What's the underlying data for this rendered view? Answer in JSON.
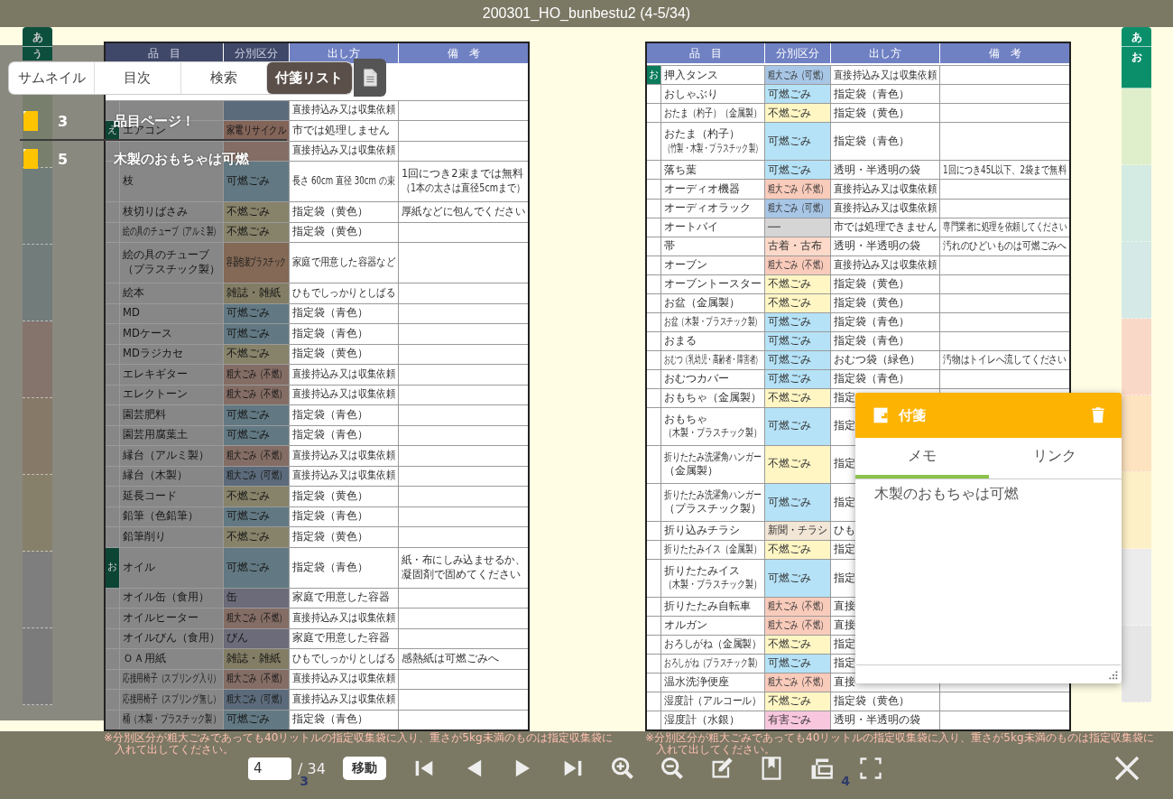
{
  "title": "200301_HO_bunbestu2 (4-5/34)",
  "left_index_tabs": [
    {
      "label": "あ",
      "color": "#0d4f3d"
    },
    {
      "label": "う",
      "color": "#0d4f3d"
    },
    {
      "color": "#787f6d"
    },
    {
      "color": "#717d79"
    },
    {
      "color": "#727c7b"
    },
    {
      "color": "#85746c"
    },
    {
      "color": "#867968"
    },
    {
      "color": "#86806b"
    },
    {
      "color": "#7e7e7e"
    },
    {
      "color": "#7b7b7b"
    }
  ],
  "right_index_tabs": [
    {
      "label": "あ",
      "color": "#0b8f6b"
    },
    {
      "label": "お",
      "color": "#0b8f6b"
    },
    {
      "color": "#e0efcb"
    },
    {
      "color": "#d3ebe3"
    },
    {
      "color": "#d5e9e6"
    },
    {
      "color": "#fad8c8"
    },
    {
      "color": "#fde3c0"
    },
    {
      "color": "#fdf0c6"
    },
    {
      "color": "#ececec"
    },
    {
      "color": "#e6e6e6"
    }
  ],
  "pages": [
    {
      "columns": [
        "品　目",
        "分別区分",
        "出し方",
        "備　考"
      ],
      "rows": [
        {
          "color": "#5c6b7b",
          "method": "直接持込み又は収集依頼"
        },
        {
          "kana": "え",
          "item": "エアコン",
          "class": "家電リサイクル",
          "color": "#836459",
          "method": "市では処理しません"
        },
        {
          "color": "#846d65",
          "method": "直接持込み又は収集依頼"
        },
        {
          "item": "枝",
          "class": "可燃ごみ",
          "color": "#627983",
          "method": "長さ 60cm 直径 30cm の束",
          "note": [
            "1回につき2束までは無料",
            "（1本の太さは直径5cmまで）"
          ]
        },
        {
          "item": "枝切りばさみ",
          "class": "不燃ごみ",
          "color": "#87836a",
          "method": "指定袋（黄色）",
          "note": "厚紙などに包んでください"
        },
        {
          "item": "絵の具のチューブ（アルミ製）",
          "class": "不燃ごみ",
          "color": "#87836a",
          "method": "指定袋（黄色）"
        },
        {
          "item": [
            "絵の具のチューブ",
            "（プラスチック製）"
          ],
          "class": "容器包装プラスチック",
          "color": "#836956",
          "method": "家庭で用意した容器など"
        },
        {
          "item": "絵本",
          "class": "雑誌・雑紙",
          "color": "#827d64",
          "method": "ひもでしっかりとしばる"
        },
        {
          "item": "MD",
          "class": "可燃ごみ",
          "color": "#627983",
          "method": "指定袋（青色）"
        },
        {
          "item": "MDケース",
          "class": "可燃ごみ",
          "color": "#627983",
          "method": "指定袋（青色）"
        },
        {
          "item": "MDラジカセ",
          "class": "不燃ごみ",
          "color": "#87836a",
          "method": "指定袋（黄色）"
        },
        {
          "item": "エレキギター",
          "class": "粗大ごみ（不燃）",
          "color": "#846d65",
          "method": "直接持込み又は収集依頼"
        },
        {
          "item": "エレクトーン",
          "class": "粗大ごみ（不燃）",
          "color": "#846d65",
          "method": "直接持込み又は収集依頼"
        },
        {
          "item": "園芸肥料",
          "class": "可燃ごみ",
          "color": "#627983",
          "method": "指定袋（青色）"
        },
        {
          "item": "園芸用腐葉土",
          "class": "可燃ごみ",
          "color": "#627983",
          "method": "指定袋（青色）"
        },
        {
          "item": "縁台（アルミ製）",
          "class": "粗大ごみ（不燃）",
          "color": "#846d65",
          "method": "直接持込み又は収集依頼"
        },
        {
          "item": "縁台（木製）",
          "class": "粗大ごみ（可燃）",
          "color": "#5c6b7b",
          "method": "直接持込み又は収集依頼"
        },
        {
          "item": "延長コード",
          "class": "不燃ごみ",
          "color": "#87836a",
          "method": "指定袋（黄色）"
        },
        {
          "item": "鉛筆（色鉛筆）",
          "class": "可燃ごみ",
          "color": "#627983",
          "method": "指定袋（青色）"
        },
        {
          "item": "鉛筆削り",
          "class": "不燃ごみ",
          "color": "#87836a",
          "method": "指定袋（黄色）"
        },
        {
          "kana": "お",
          "item": "オイル",
          "class": "可燃ごみ",
          "color": "#627983",
          "method": "指定袋（青色）",
          "note": [
            "紙・布にしみ込ませるか、",
            "凝固剤で固めてください"
          ]
        },
        {
          "item": "オイル缶（食用）",
          "class": "缶",
          "color": "#6c6b7a",
          "method": "家庭で用意した容器"
        },
        {
          "item": "オイルヒーター",
          "class": "粗大ごみ（不燃）",
          "color": "#846d65",
          "method": "直接持込み又は収集依頼"
        },
        {
          "item": "オイルびん（食用）",
          "class": "びん",
          "color": "#6c6b7a",
          "method": "家庭で用意した容器"
        },
        {
          "item": "ＯＡ用紙",
          "class": "雑誌・雑紙",
          "color": "#827d64",
          "method": "ひもでしっかりとしばる",
          "note": "感熱紙は可燃ごみへ"
        },
        {
          "item": "応接用椅子（スプリング入り）",
          "class": "粗大ごみ（不燃）",
          "color": "#846d65",
          "method": "直接持込み又は収集依頼"
        },
        {
          "item": "応接用椅子（スプリング無し）",
          "class": "粗大ごみ（可燃）",
          "color": "#5c6b7b",
          "method": "直接持込み又は収集依頼"
        },
        {
          "item": "桶（木製・プラスチック製）",
          "class": "可燃ごみ",
          "color": "#627983",
          "method": "指定袋（青色）"
        }
      ],
      "footnote": [
        "※分別区分が粗大ごみであっても40リットルの指定収集袋に入り、重さが5kg未満のものは指定収集袋に",
        "入れて出してください。"
      ],
      "page_number": "3"
    },
    {
      "columns": [
        "品　目",
        "分別区分",
        "出し方",
        "備　考"
      ],
      "rows": [
        {
          "kana": "お",
          "item": "押入タンス",
          "class": "粗大ごみ（可燃）",
          "color": "#a8c6e6",
          "method": "直接持込み又は収集依頼"
        },
        {
          "item": "おしゃぶり",
          "class": "可燃ごみ",
          "color": "#b5e2f7",
          "method": "指定袋（青色）"
        },
        {
          "item": "おたま（杓子）（金属製）",
          "class": "不燃ごみ",
          "color": "#fff6c4",
          "method": "指定袋（黄色）"
        },
        {
          "item": [
            "おたま（杓子）",
            "（竹製・木製・プラスチック製）"
          ],
          "class": "可燃ごみ",
          "color": "#b5e2f7",
          "method": "指定袋（青色）"
        },
        {
          "item": "落ち葉",
          "class": "可燃ごみ",
          "color": "#b5e2f7",
          "method": "透明・半透明の袋",
          "note": "1回につき45L以下、2袋まで無料"
        },
        {
          "item": "オーディオ機器",
          "class": "粗大ごみ（不燃）",
          "color": "#f9cbbb",
          "method": "直接持込み又は収集依頼"
        },
        {
          "item": "オーディオラック",
          "class": "粗大ごみ（可燃）",
          "color": "#a8c6e6",
          "method": "直接持込み又は収集依頼"
        },
        {
          "item": "オートバイ",
          "class": "──",
          "color": "#d5d5d5",
          "method": "市では処理できません",
          "note": "専門業者に処理を依頼してください"
        },
        {
          "item": "帯",
          "class": "古着・古布",
          "color": "#fcd9c9",
          "method": "透明・半透明の袋",
          "note": "汚れのひどいものは可燃ごみへ"
        },
        {
          "item": "オーブン",
          "class": "粗大ごみ（不燃）",
          "color": "#f9cbbb",
          "method": "直接持込み又は収集依頼"
        },
        {
          "item": "オーブントースター",
          "class": "不燃ごみ",
          "color": "#fff6c4",
          "method": "指定袋（黄色）"
        },
        {
          "item": "お盆（金属製）",
          "class": "不燃ごみ",
          "color": "#fff6c4",
          "method": "指定袋（黄色）"
        },
        {
          "item": "お盆（木製・プラスチック製）",
          "class": "可燃ごみ",
          "color": "#b5e2f7",
          "method": "指定袋（青色）"
        },
        {
          "item": "おまる",
          "class": "可燃ごみ",
          "color": "#b5e2f7",
          "method": "指定袋（青色）"
        },
        {
          "item": "おむつ（乳幼児・高齢者・障害者）",
          "class": "可燃ごみ",
          "color": "#b5e2f7",
          "method": "おむつ袋（緑色）",
          "note": "汚物はトイレへ流してください"
        },
        {
          "item": "おむつカバー",
          "class": "可燃ごみ",
          "color": "#b5e2f7",
          "method": "指定袋（青色）"
        },
        {
          "item": "おもちゃ（金属製）",
          "class": "不燃ごみ",
          "color": "#fff6c4",
          "method": "指定"
        },
        {
          "item": [
            "おもちゃ",
            "（木製・プラスチック製）"
          ],
          "class": "可燃ごみ",
          "color": "#b5e2f7",
          "method": "指定"
        },
        {
          "item": [
            "折りたたみ洗濯角ハンガー",
            "（金属製）"
          ],
          "class": "不燃ごみ",
          "color": "#fff6c4",
          "method": "指定"
        },
        {
          "item": [
            "折りたたみ洗濯角ハンガー",
            "（プラスチック製）"
          ],
          "class": "可燃ごみ",
          "color": "#b5e2f7",
          "method": "指定"
        },
        {
          "item": "折り込みチラシ",
          "class": "新聞・チラシ",
          "color": "#f2e6d6",
          "method": "ひも"
        },
        {
          "item": "折りたたみイス（金属製）",
          "class": "不燃ごみ",
          "color": "#fff6c4",
          "method": "指定"
        },
        {
          "item": [
            "折りたたみイス",
            "（木製・プラスチック製）"
          ],
          "class": "可燃ごみ",
          "color": "#b5e2f7",
          "method": "指定"
        },
        {
          "item": "折りたたみ自転車",
          "class": "粗大ごみ（不燃）",
          "color": "#f9cbbb",
          "method": "直接"
        },
        {
          "item": "オルガン",
          "class": "粗大ごみ（不燃）",
          "color": "#f9cbbb",
          "method": "直接"
        },
        {
          "item": "おろしがね（金属製）",
          "class": "不燃ごみ",
          "color": "#fff6c4",
          "method": "指定"
        },
        {
          "item": "おろしがね（プラスチック製）",
          "class": "可燃ごみ",
          "color": "#b5e2f7",
          "method": "指定"
        },
        {
          "item": "温水洗浄便座",
          "class": "粗大ごみ（不燃）",
          "color": "#f9cbbb",
          "method": "直接"
        },
        {
          "item": "湿度計（アルコール）",
          "class": "不燃ごみ",
          "color": "#fff6c4",
          "method": "指定袋（黄色）"
        },
        {
          "item": "湿度計（水銀）",
          "class": "有害ごみ",
          "color": "#f8c6dd",
          "method": "透明・半透明の袋"
        }
      ],
      "footnote": [
        "※分別区分が粗大ごみであっても40リットルの指定収集袋に入り、重さが5kg未満のものは指定収集袋に",
        "入れて出してください。"
      ],
      "page_number": "4"
    }
  ],
  "sidebar": {
    "tabs": [
      {
        "label": "サムネイル",
        "selected": false
      },
      {
        "label": "目次",
        "selected": false
      },
      {
        "label": "検索",
        "selected": false
      },
      {
        "label": "付箋リスト",
        "selected": true
      }
    ],
    "notes": [
      {
        "page": "3",
        "text": "品目ページ！"
      },
      {
        "page": "5",
        "text": "木製のおもちゃは可燃"
      }
    ]
  },
  "note_popup": {
    "title": "付箋",
    "tabs": [
      {
        "label": "メモ",
        "selected": true
      },
      {
        "label": "リンク",
        "selected": false
      }
    ],
    "memo": "木製のおもちゃは可燃"
  },
  "toolbar": {
    "page_input": "4",
    "page_total": "/ 34",
    "go_button": "移動"
  }
}
